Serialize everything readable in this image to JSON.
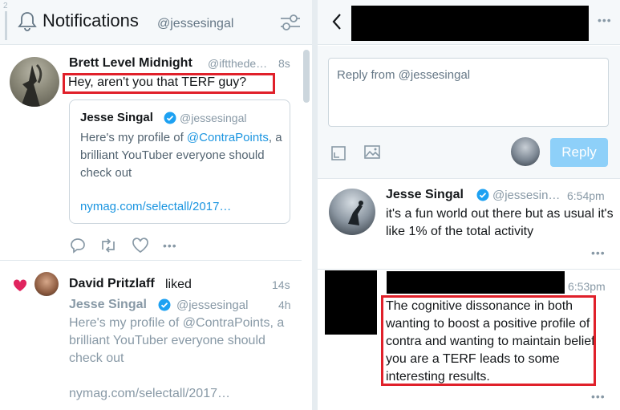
{
  "notifications_column": {
    "handle_number": "2",
    "title": "Notifications",
    "account": "@jessesingal",
    "items": [
      {
        "type": "reply",
        "name": "Brett Level Midnight",
        "handle": "@iftthede…",
        "time": "8s",
        "text": "Hey, aren't you that TERF guy?",
        "quoted": {
          "name": "Jesse Singal",
          "handle": "@jessesingal",
          "text_before": "Here's my profile of ",
          "mention": "@ContraPoints",
          "text_after": ", a brilliant YouTuber everyone should check out",
          "link": "nymag.com/selectall/2017…"
        }
      },
      {
        "type": "like",
        "name": "David Pritzlaff",
        "action": "liked",
        "time": "14s",
        "quoted_name": "Jesse Singal",
        "quoted_handle": "@jessesingal",
        "quoted_time": "4h",
        "quoted_text": "Here's my profile of @ContraPoints, a brilliant YouTuber everyone should check out",
        "quoted_link": "nymag.com/selectall/2017…"
      }
    ]
  },
  "conversation_column": {
    "reply_placeholder": "Reply from @jessesingal",
    "reply_button": "Reply",
    "tweets": [
      {
        "name": "Jesse Singal",
        "handle": "@jessesin…",
        "time": "6:54pm",
        "text": "it's a fun world out there but as usual it's like 1% of the total activity"
      },
      {
        "time": "6:53pm",
        "text": "The cognitive dissonance in both wanting to boost a positive profile of contra and wanting to maintain belief you are a TERF leads to some interesting results."
      }
    ]
  },
  "colors": {
    "accent": "#1b95e0",
    "highlight_box": "#e0202a",
    "like_heart": "#e0245e",
    "reply_button_disabled": "#8ed0f9"
  },
  "icons": [
    "bell-icon",
    "filter-icon",
    "verified-icon",
    "reply-icon",
    "retweet-icon",
    "like-icon",
    "more-icon",
    "heart-icon",
    "back-icon",
    "media-icon",
    "image-icon"
  ]
}
